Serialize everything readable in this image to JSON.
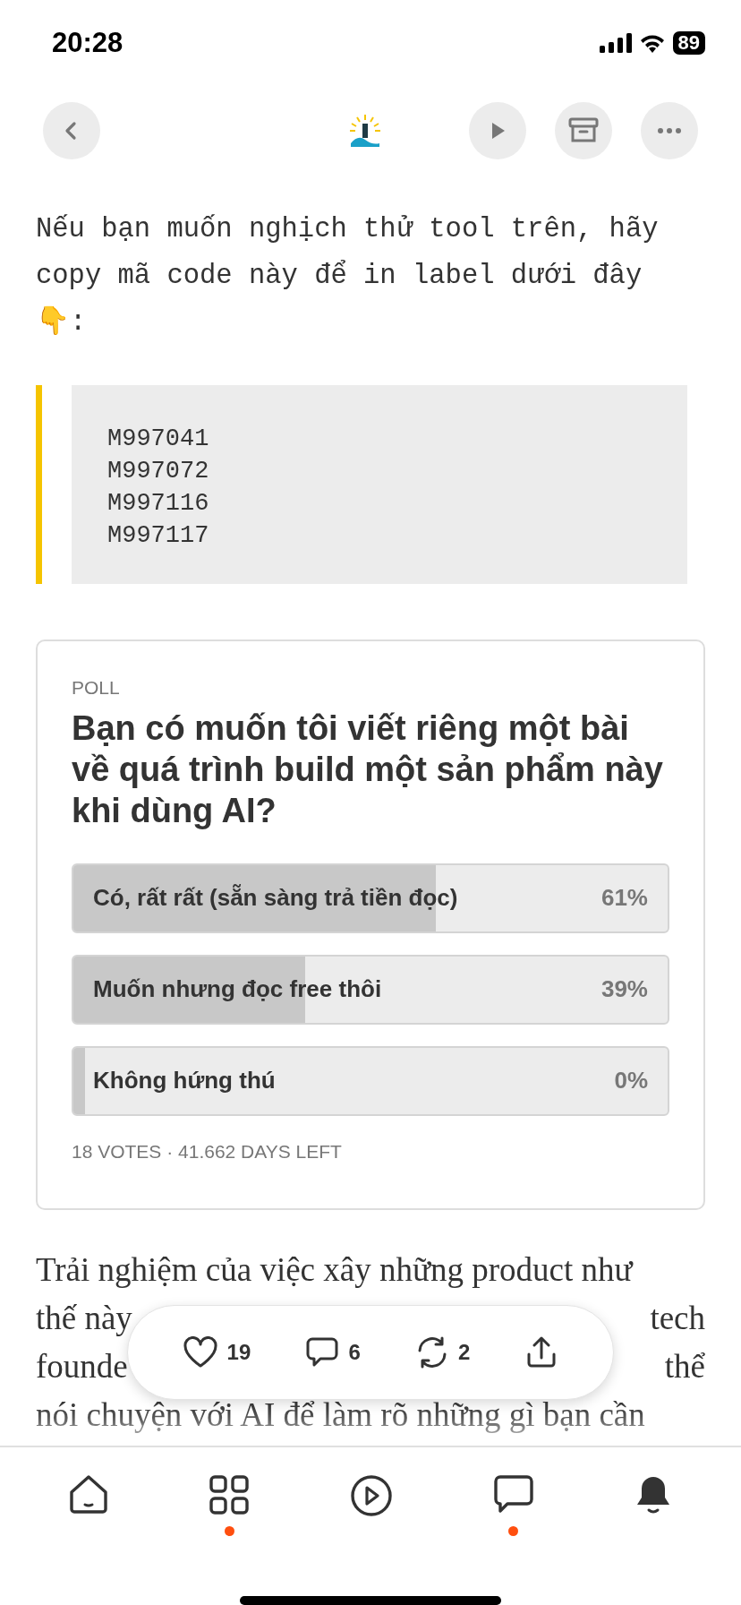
{
  "status_bar": {
    "time": "20:28",
    "battery": "89"
  },
  "intro": {
    "text": "Nếu bạn muốn nghịch thử tool trên, hãy copy mã code này để in label dưới đây 👇:"
  },
  "code_block": {
    "lines": [
      "M997041",
      "M997072",
      "M997116",
      "M997117"
    ]
  },
  "poll": {
    "label": "POLL",
    "question": "Bạn có muốn tôi viết riêng một bài về quá trình build một sản phẩm này khi dùng AI?",
    "options": [
      {
        "text": "Có, rất rất (sẵn sàng trả tiền đọc)",
        "percent": "61%",
        "level": 0.61
      },
      {
        "text": "Muốn nhưng đọc free thôi",
        "percent": "39%",
        "level": 0.39
      },
      {
        "text": "Không hứng thú",
        "percent": "0%",
        "level": 0.0
      }
    ],
    "footer": "18 VOTES · 41.662 DAYS LEFT"
  },
  "body_lines": [
    [
      "Trải nghiệm của việc xây những product như"
    ],
    [
      "thế này",
      "tech"
    ],
    [
      "founde",
      "thể"
    ],
    [
      "nói chuyện với AI để làm rõ những gì bạn cần"
    ]
  ],
  "actions": [
    {
      "kind": "like",
      "count": "19"
    },
    {
      "kind": "comment",
      "count": "6"
    },
    {
      "kind": "restack",
      "count": "2"
    },
    {
      "kind": "share"
    }
  ],
  "tabs": [
    {
      "kind": "home",
      "dot": false
    },
    {
      "kind": "grid",
      "dot": true
    },
    {
      "kind": "play",
      "dot": false
    },
    {
      "kind": "chat",
      "dot": true
    },
    {
      "kind": "bell",
      "dot": false
    }
  ]
}
